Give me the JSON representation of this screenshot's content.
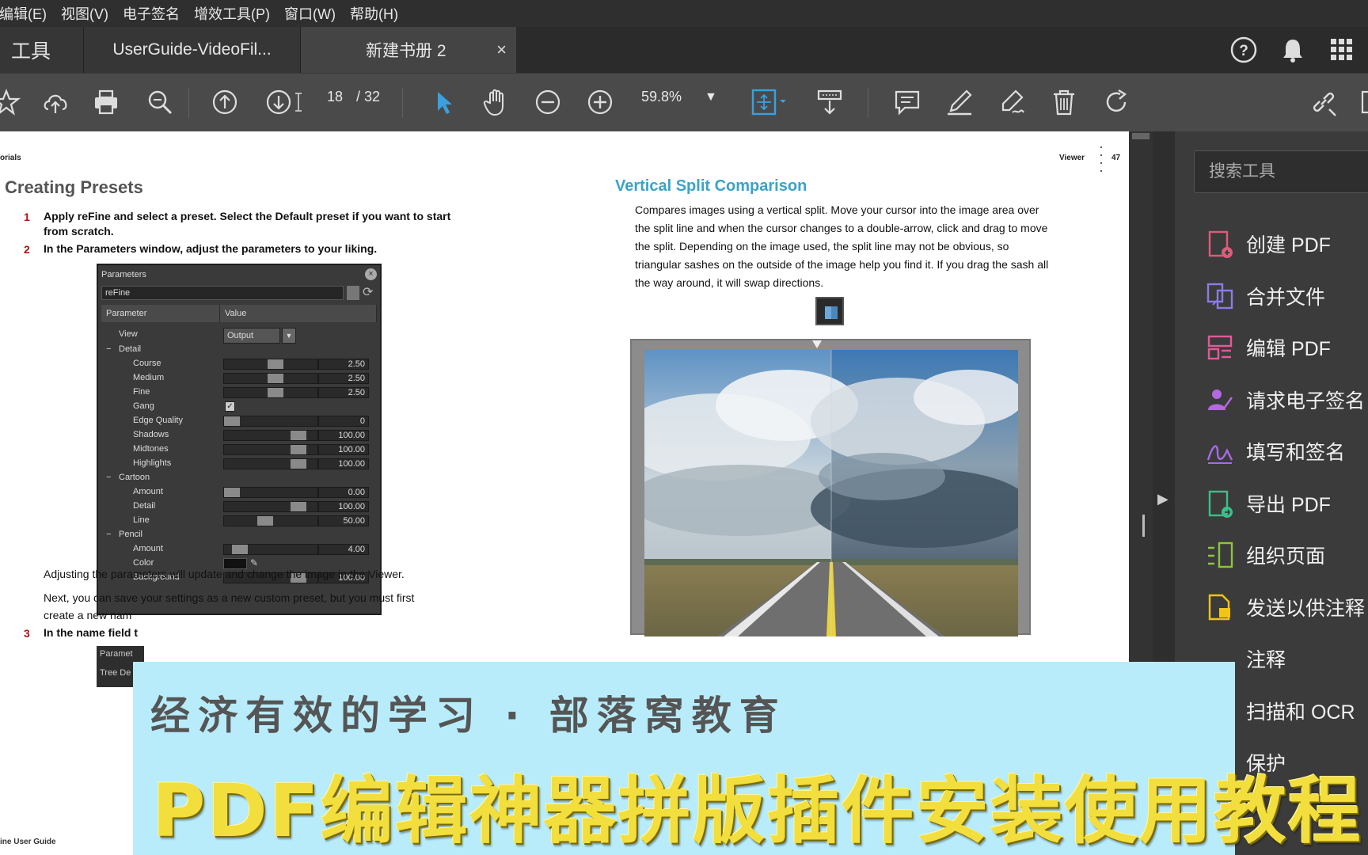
{
  "menu": [
    "编辑(E)",
    "视图(V)",
    "电子签名",
    "增效工具(P)",
    "窗口(W)",
    "帮助(H)"
  ],
  "tabs": {
    "tools": "工具",
    "guide": "UserGuide-VideoFil...",
    "active": "新建书册 2",
    "close": "×"
  },
  "toolbar": {
    "page_current": "18",
    "page_total": "/ 32",
    "zoom": "59.8%"
  },
  "doc": {
    "header_left": "orials",
    "header_right": "Viewer",
    "page_no": "47",
    "footer": "ine User Guide",
    "left_heading": "Creating Presets",
    "steps": [
      {
        "num": "1",
        "text": "Apply reFine and select a preset. Select the Default preset if you want to start from scratch."
      },
      {
        "num": "2",
        "text": "In the Parameters window, adjust the parameters to your liking."
      },
      {
        "num": "3",
        "text": "In the name field t"
      }
    ],
    "para1": "Adjusting the parameters will update and change the image in the Viewer.",
    "para2a": "Next, you can save your settings as a new custom preset, but you must first",
    "para2b": "create a new nam",
    "mini_panel_title": "Paramet",
    "mini_panel_row": "Tree De",
    "right_heading": "Vertical Split Comparison",
    "right_para": "Compares images using a vertical split. Move your cursor into the image area over the split line and when the cursor changes to a double-arrow, click and drag to move the split. Depending on the image used, the split line may not be obvious, so triangular sashes on the outside of the image help you find it. If you drag the sash all the way around, it will swap directions."
  },
  "params": {
    "title": "Parameters",
    "preset": "reFine",
    "col_param": "Parameter",
    "col_value": "Value",
    "view_label": "View",
    "view_value": "Output",
    "rows": [
      {
        "name": "Detail",
        "group": true
      },
      {
        "name": "Course",
        "value": "2.50",
        "level": 0.55
      },
      {
        "name": "Medium",
        "value": "2.50",
        "level": 0.55
      },
      {
        "name": "Fine",
        "value": "2.50",
        "level": 0.55
      },
      {
        "name": "Gang",
        "check": true
      },
      {
        "name": "Edge Quality",
        "value": "0",
        "level": 0.0
      },
      {
        "name": "Shadows",
        "value": "100.00",
        "level": 0.84
      },
      {
        "name": "Midtones",
        "value": "100.00",
        "level": 0.84
      },
      {
        "name": "Highlights",
        "value": "100.00",
        "level": 0.84
      },
      {
        "name": "Cartoon",
        "group": true
      },
      {
        "name": "Amount",
        "value": "0.00",
        "level": 0.0
      },
      {
        "name": "Detail",
        "value": "100.00",
        "level": 0.84
      },
      {
        "name": "Line",
        "value": "50.00",
        "level": 0.42
      },
      {
        "name": "Pencil",
        "group": true
      },
      {
        "name": "Amount",
        "value": "4.00",
        "level": 0.1
      },
      {
        "name": "Color",
        "color": true
      },
      {
        "name": "Background",
        "value": "100.00",
        "level": 0.84
      }
    ]
  },
  "right_panel": {
    "search_placeholder": "搜索工具",
    "items": [
      {
        "label": "创建 PDF",
        "icon": "create-pdf-icon",
        "color": "#e05a7a"
      },
      {
        "label": "合并文件",
        "icon": "combine-files-icon",
        "color": "#8b7be8"
      },
      {
        "label": "编辑 PDF",
        "icon": "edit-pdf-icon",
        "color": "#e05a9a"
      },
      {
        "label": "请求电子签名",
        "icon": "request-esign-icon",
        "color": "#b569e0"
      },
      {
        "label": "填写和签名",
        "icon": "fill-sign-icon",
        "color": "#a86ae8"
      },
      {
        "label": "导出 PDF",
        "icon": "export-pdf-icon",
        "color": "#3bbf8a"
      },
      {
        "label": "组织页面",
        "icon": "organize-pages-icon",
        "color": "#8cc63f"
      },
      {
        "label": "发送以供注释",
        "icon": "send-comment-icon",
        "color": "#f0c419"
      },
      {
        "label": "注释",
        "icon": "comment-icon",
        "color": "#f0c419"
      },
      {
        "label": "扫描和 OCR",
        "icon": "scan-ocr-icon",
        "color": "#3bbf8a"
      },
      {
        "label": "保护",
        "icon": "protect-icon",
        "color": "#b569e0"
      }
    ]
  },
  "banner": {
    "subtitle": "经济有效的学习 · 部落窝教育",
    "title": "PDF编辑神器拼版插件安装使用教程"
  }
}
